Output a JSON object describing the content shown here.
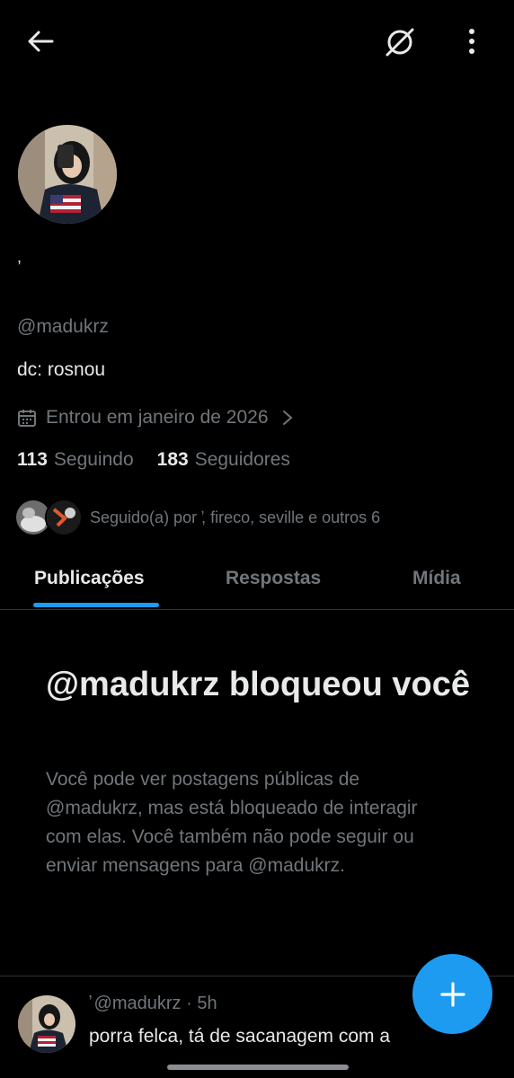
{
  "header": {
    "back_icon": "arrow-left-icon",
    "grok_icon": "grok-icon",
    "more_icon": "more-vertical-icon"
  },
  "profile": {
    "display_name": ",",
    "handle": "@madukrz",
    "bio": "dc: rosnou",
    "joined": "Entrou em janeiro de 2026",
    "following_count": "113",
    "following_label": "Seguindo",
    "followers_count": "183",
    "followers_label": "Seguidores",
    "followed_by": "Seguido(a) por ̛, fireco, seville e outros 6"
  },
  "tabs": [
    {
      "label": "Publicações",
      "active": true
    },
    {
      "label": "Respostas",
      "active": false
    },
    {
      "label": "Mídia",
      "active": false
    }
  ],
  "blocked": {
    "title": "@madukrz bloqueou você",
    "body": "Você pode ver postagens públicas de @madukrz, mas está bloqueado de interagir com elas. Você também não pode seguir ou enviar mensagens para @madukrz."
  },
  "post": {
    "header": "̛ @madukrz · 5h",
    "text": "porra felca, tá de sacanagem com a"
  },
  "fab": {
    "icon": "plus-icon"
  },
  "colors": {
    "background": "#000000",
    "text_primary": "#e7e9ea",
    "text_secondary": "#71767b",
    "accent": "#1d9bf0",
    "divider": "#2f3336"
  }
}
